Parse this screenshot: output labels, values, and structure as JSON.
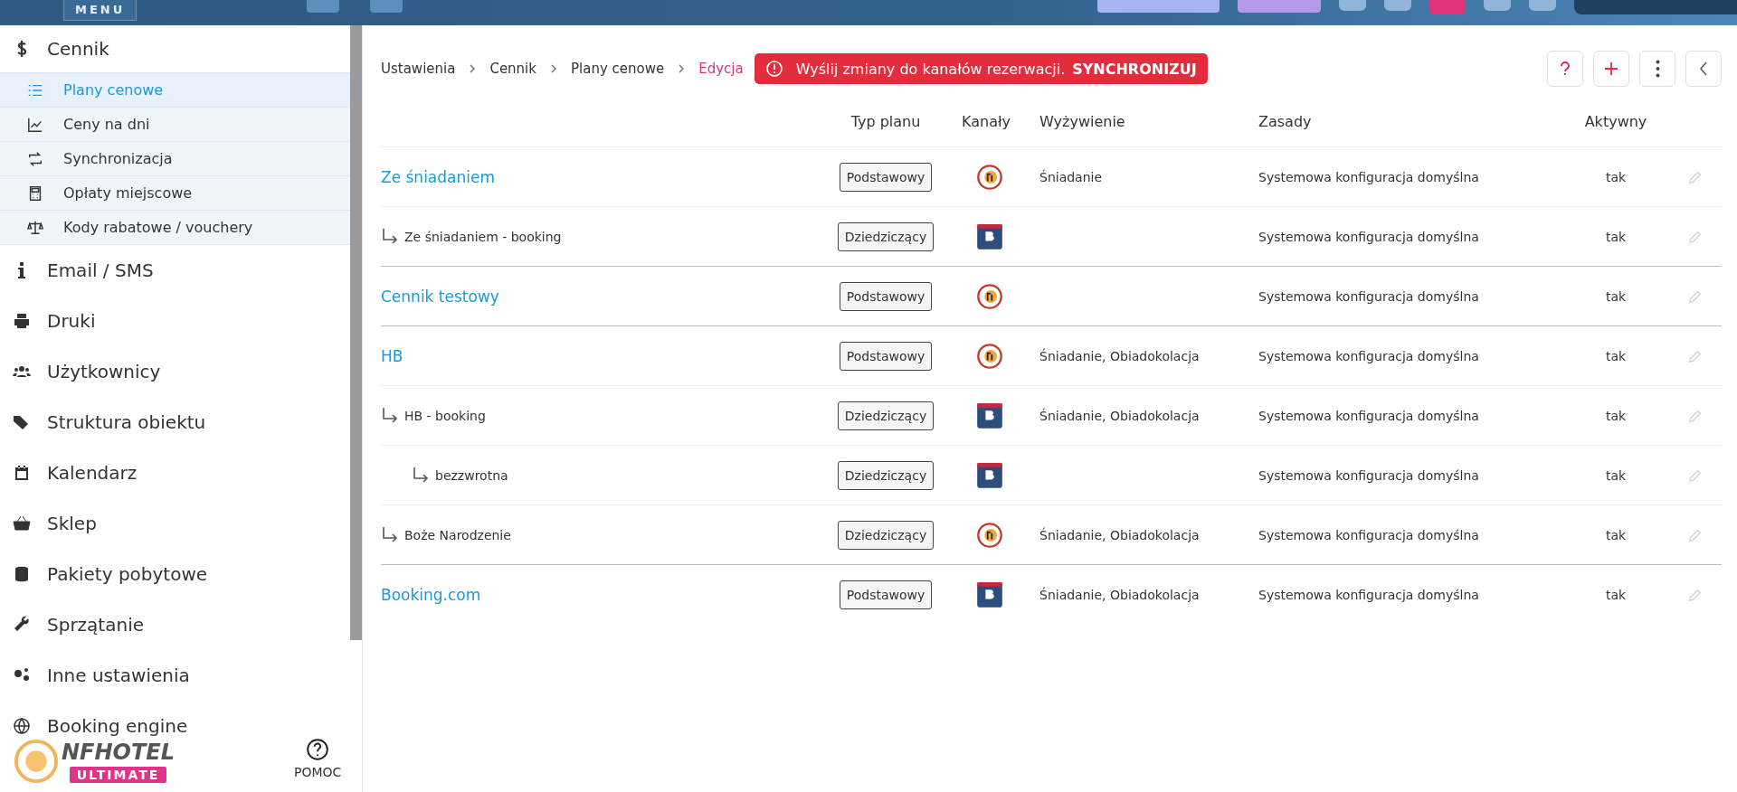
{
  "topbar": {
    "menu_label": "MENU"
  },
  "sidebar": {
    "items": [
      {
        "label": "Cennik",
        "children": [
          {
            "label": "Plany cenowe",
            "selected": true
          },
          {
            "label": "Ceny na dni",
            "selected": false
          },
          {
            "label": "Synchronizacja",
            "selected": false
          },
          {
            "label": "Opłaty miejscowe",
            "selected": false
          },
          {
            "label": "Kody rabatowe / vouchery",
            "selected": false
          }
        ]
      },
      {
        "label": "Email / SMS"
      },
      {
        "label": "Druki"
      },
      {
        "label": "Użytkownicy"
      },
      {
        "label": "Struktura obiektu"
      },
      {
        "label": "Kalendarz"
      },
      {
        "label": "Sklep"
      },
      {
        "label": "Pakiety pobytowe"
      },
      {
        "label": "Sprzątanie"
      },
      {
        "label": "Inne ustawienia"
      },
      {
        "label": "Booking engine"
      }
    ],
    "logo": {
      "name": "NFHOTEL",
      "edition": "ULTIMATE"
    },
    "help": "POMOC"
  },
  "breadcrumb": [
    "Ustawienia",
    "Cennik",
    "Plany cenowe",
    "Edycja"
  ],
  "alert": {
    "text": "Wyślij zmiany do kanałów rezerwacji.",
    "action": "SYNCHRONIZUJ"
  },
  "table": {
    "columns": [
      "Typ planu",
      "Kanały",
      "Wyżywienie",
      "Zasady",
      "Aktywny"
    ],
    "rows": [
      {
        "name": "Ze śniadaniem",
        "type": "Podstawowy",
        "kind": "nfhotel",
        "board": "Śniadanie",
        "rules": "Systemowa konfiguracja domyślna",
        "active": "tak",
        "children": [
          {
            "name": "Ze śniadaniem - booking",
            "type": "Dziedziczący",
            "kind": "booking",
            "rules": "Systemowa konfiguracja domyślna",
            "active": "tak"
          }
        ]
      },
      {
        "name": "Cennik testowy",
        "type": "Podstawowy",
        "kind": "nfhotel",
        "rules": "Systemowa konfiguracja domyślna",
        "active": "tak"
      },
      {
        "name": "HB",
        "type": "Podstawowy",
        "kind": "nfhotel",
        "board": "Śniadanie, Obiadokolacja",
        "rules": "Systemowa konfiguracja domyślna",
        "active": "tak",
        "children": [
          {
            "name": "HB - booking",
            "type": "Dziedziczący",
            "kind": "booking",
            "board": "Śniadanie, Obiadokolacja",
            "rules": "Systemowa konfiguracja domyślna",
            "active": "tak",
            "children": [
              {
                "name": "bezzwrotna",
                "type": "Dziedziczący",
                "kind": "booking",
                "rules": "Systemowa konfiguracja domyślna",
                "active": "tak"
              }
            ]
          },
          {
            "name": "Boże Narodzenie",
            "type": "Dziedziczący",
            "kind": "nfhotel",
            "board": "Śniadanie, Obiadokolacja",
            "rules": "Systemowa konfiguracja domyślna",
            "active": "tak"
          }
        ]
      },
      {
        "name": "Booking.com",
        "type": "Podstawowy",
        "kind": "booking",
        "board": "Śniadanie, Obiadokolacja",
        "rules": "Systemowa konfiguracja domyślna",
        "active": "tak"
      }
    ]
  }
}
